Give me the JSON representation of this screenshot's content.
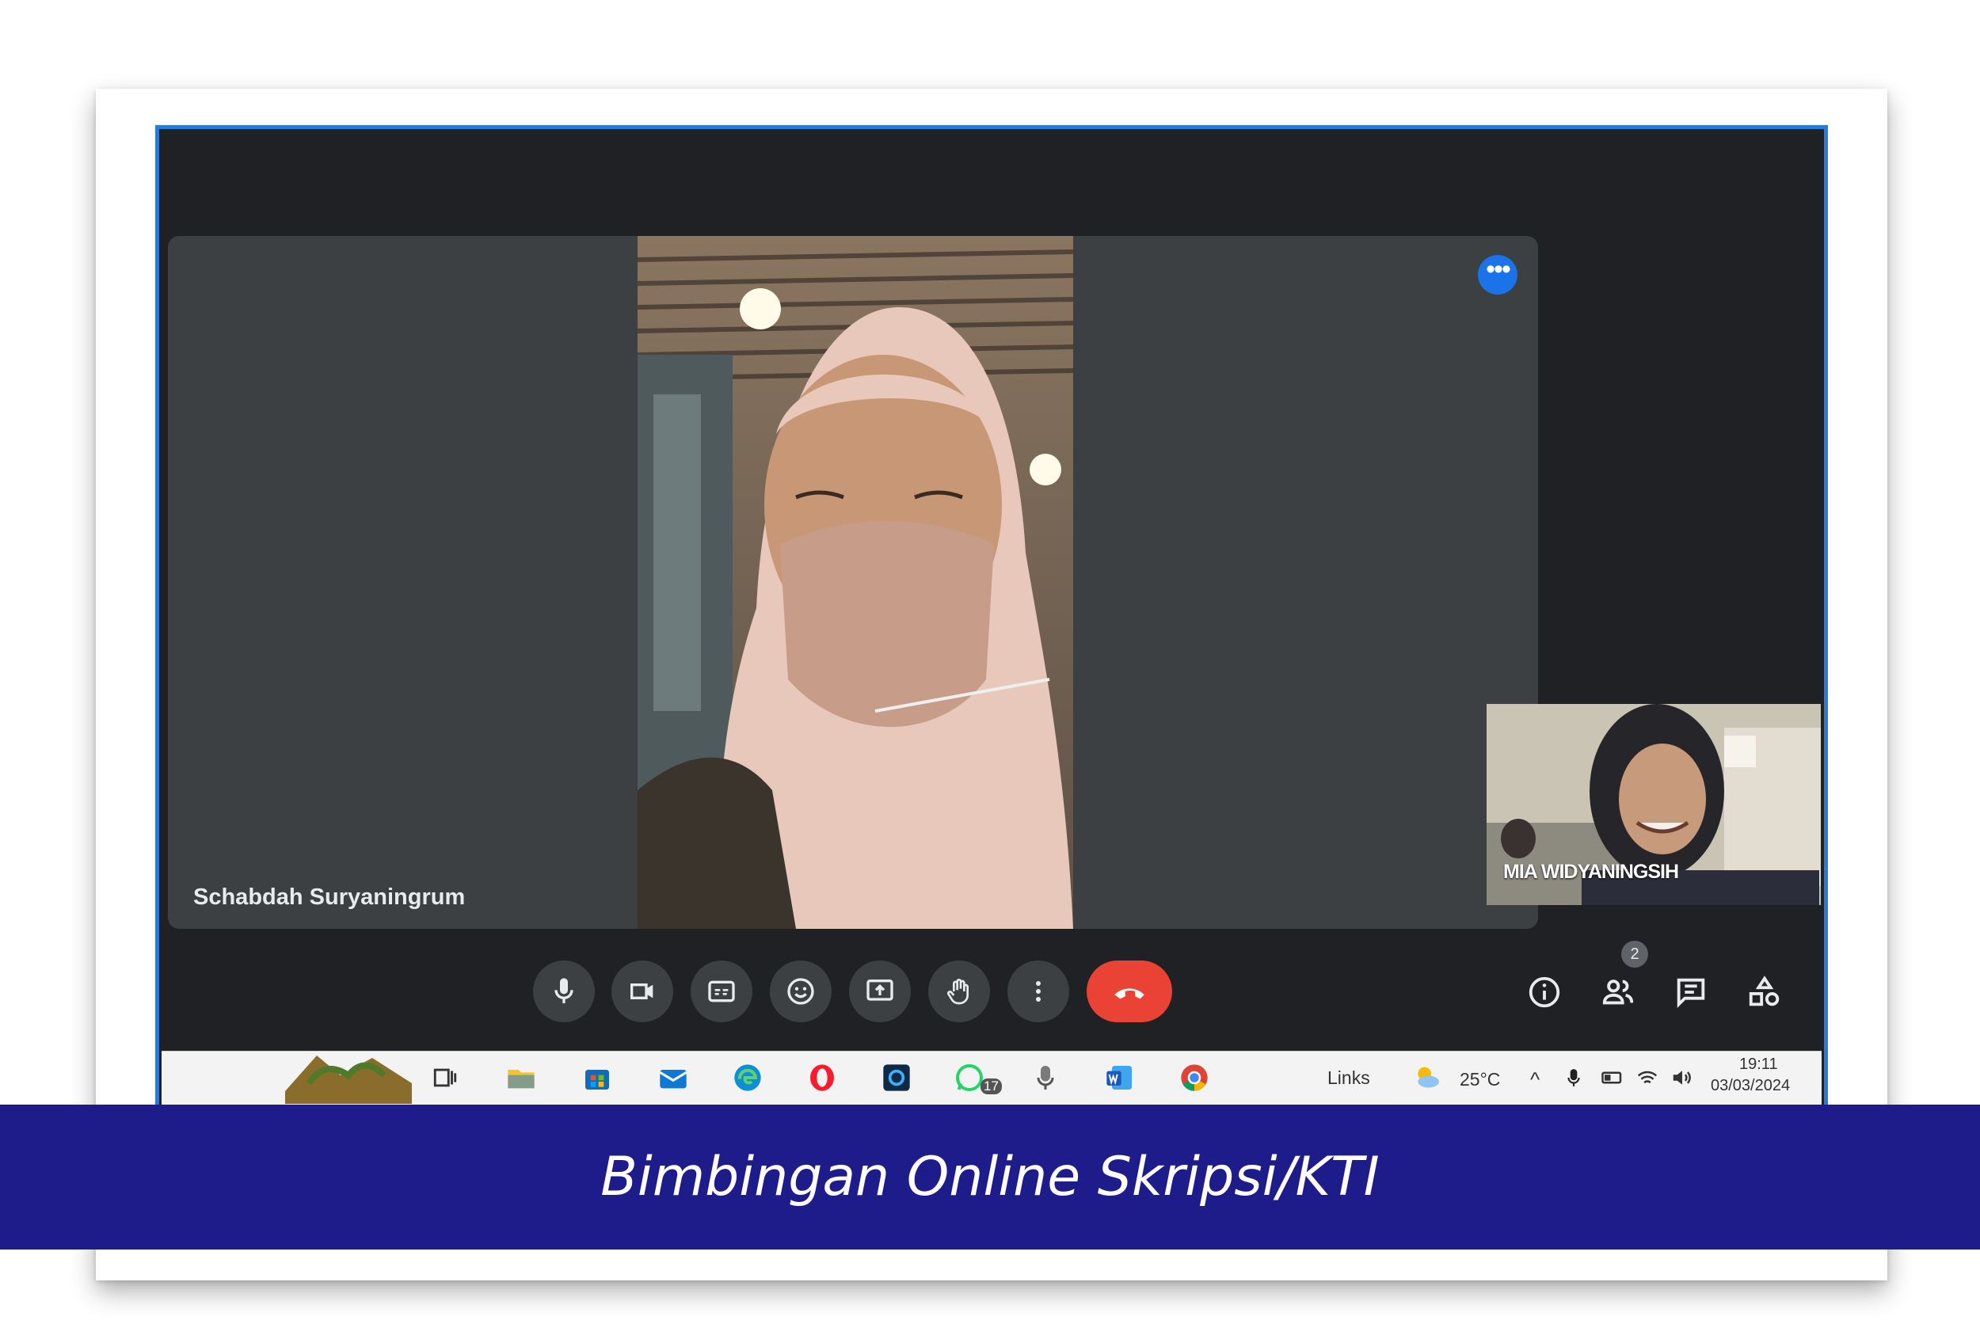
{
  "meeting": {
    "main_participant_name": "Schabdah Suryaningrum",
    "self_participant_name": "MIA WIDYANINGSIH",
    "participant_count": "2"
  },
  "controls": {
    "items": [
      {
        "name": "microphone-button",
        "icon": "mic-icon"
      },
      {
        "name": "camera-button",
        "icon": "camera-icon"
      },
      {
        "name": "captions-button",
        "icon": "captions-icon"
      },
      {
        "name": "reactions-button",
        "icon": "emoji-icon"
      },
      {
        "name": "present-button",
        "icon": "present-icon"
      },
      {
        "name": "raise-hand-button",
        "icon": "hand-icon"
      },
      {
        "name": "more-options-button",
        "icon": "more-vert-icon"
      },
      {
        "name": "leave-call-button",
        "icon": "end-call-icon"
      }
    ],
    "right": [
      {
        "name": "meeting-info-button",
        "icon": "info-icon"
      },
      {
        "name": "people-button",
        "icon": "people-icon"
      },
      {
        "name": "chat-button",
        "icon": "chat-icon"
      },
      {
        "name": "activities-button",
        "icon": "shapes-icon"
      }
    ]
  },
  "taskbar": {
    "links_label": "Links",
    "weather": "25°C",
    "time": "19:11",
    "date": "03/03/2024",
    "whatsapp_badge": "17"
  },
  "colors": {
    "accent_border": "#2a7bd6",
    "banner": "#1e1c8a",
    "end_call": "#ea4335",
    "tile_bg": "#3c4043"
  },
  "caption": "Bimbingan Online Skripsi/KTI"
}
